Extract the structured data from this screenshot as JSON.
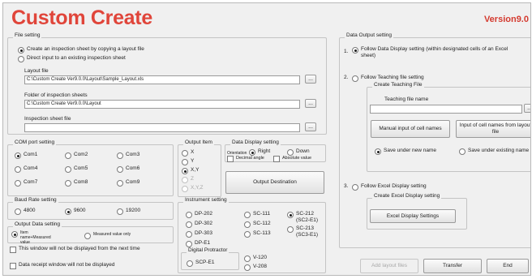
{
  "title": "Custom Create",
  "version": "Version9.0",
  "file_setting": {
    "label": "File setting",
    "opt_copy": "Create an inspection sheet by copying a layout file",
    "opt_direct": "Direct input to an existing inspection sheet",
    "layout_label": "Layout file",
    "layout_value": "C:\\Custom Create Ver9.0.0\\Layout\\Sample_Layout.xls",
    "folder_label": "Folder of inspection sheets",
    "folder_value": "C:\\Custom Create Ver9.0.0\\Layout",
    "sheet_label": "Inspection sheet file",
    "sheet_value": "",
    "browse": "..."
  },
  "com": {
    "label": "COM port setting",
    "ports": [
      "Com1",
      "Com2",
      "Com3",
      "Com4",
      "Com5",
      "Com6",
      "Com7",
      "Com8",
      "Com9"
    ],
    "selected": "Com1"
  },
  "baud": {
    "label": "Baud Rate setting",
    "rates": [
      "4800",
      "9600",
      "19200"
    ],
    "selected": "9600"
  },
  "output_data": {
    "label": "Output Data setting",
    "opt_a": "Item name+Measured value",
    "opt_b": "Measured value only"
  },
  "window_checks": {
    "no_display": "This window will not be displayed from the next time",
    "receipt": "Data receipt window will not be displayed"
  },
  "output_item": {
    "label": "Output Item",
    "items": [
      "X",
      "Y",
      "X,Y",
      "Z",
      "X,Y,Z"
    ],
    "selected": "X,Y"
  },
  "display": {
    "label": "Data Display setting",
    "direction_label": "Orientation",
    "right": "Right",
    "down": "Down",
    "decimal": "Decimal angle",
    "absolute": "Absolute value"
  },
  "output_dest": "Output Destination",
  "instrument": {
    "label": "Instrument setting",
    "col1": [
      "DP-202",
      "DP-302",
      "DP-303",
      "DP-E1"
    ],
    "col2": [
      "SC-111",
      "SC-112",
      "SC-113"
    ],
    "col3": [
      "SC-212 (SC2-E1)",
      "SC-213 (SC3-E1)"
    ],
    "selected": "SC-212 (SC2-E1)",
    "protractor_label": "Digital Protractor",
    "protractor": "SCP-E1",
    "extra": [
      "V-120",
      "V-208"
    ]
  },
  "data_output": {
    "label": "Data Output setting",
    "opt1_num": "1.",
    "opt1": "Follow Data Display setting (within designated cells of an Excel sheet)",
    "opt2_num": "2.",
    "opt2": "Follow Teaching file setting",
    "teaching_group": "Create Teaching File",
    "teaching_name_label": "Teaching file name",
    "teaching_name_value": "",
    "manual_btn": "Manual input of cell names",
    "layout_btn": "Input of cell names from layout file",
    "save_new": "Save under new name",
    "save_existing": "Save under existing name",
    "opt3_num": "3.",
    "opt3": "Follow Excel Display setting",
    "excel_group": "Create Excel Display setting",
    "excel_btn": "Excel Display Settings"
  },
  "bottom": {
    "add_layout": "Add layout files",
    "transfer": "Transfer",
    "end": "End"
  },
  "colors": {
    "title": "#e0453a",
    "version": "#d43a2f",
    "window_bg": "#f0f0f0"
  }
}
